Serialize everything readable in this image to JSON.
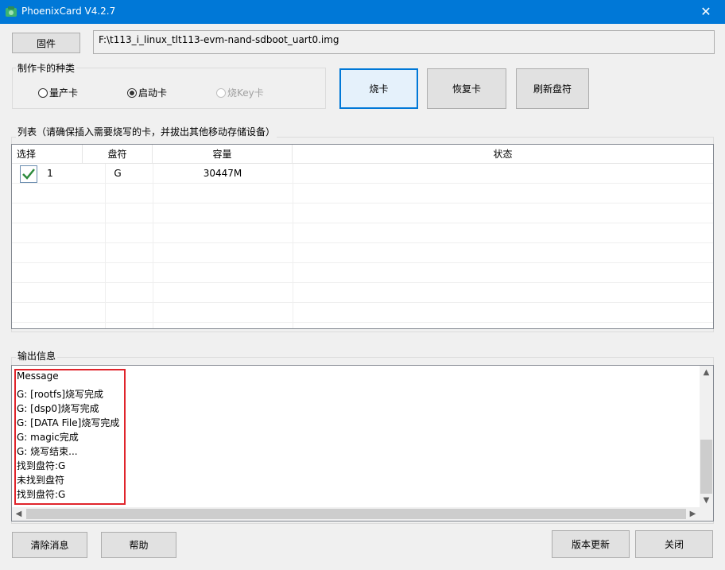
{
  "window": {
    "title": "PhoenixCard V4.2.7",
    "close_glyph": "✕"
  },
  "firmware": {
    "button_label": "固件",
    "path": "F:\\t113_i_linux_tlt113-evm-nand-sdboot_uart0.img"
  },
  "card_type": {
    "label": "制作卡的种类",
    "options": [
      {
        "label": "量产卡",
        "selected": false,
        "enabled": true
      },
      {
        "label": "启动卡",
        "selected": true,
        "enabled": true
      },
      {
        "label": "烧Key卡",
        "selected": false,
        "enabled": false
      }
    ]
  },
  "actions": {
    "burn_label": "烧卡",
    "restore_label": "恢复卡",
    "refresh_label": "刷新盘符"
  },
  "list": {
    "label": "列表（请确保插入需要烧写的卡，并拔出其他移动存储设备）",
    "columns": [
      "选择",
      "盘符",
      "容量",
      "状态"
    ],
    "rows": [
      {
        "checked": true,
        "index": "1",
        "drive": "G",
        "capacity": "30447M",
        "status": ""
      }
    ]
  },
  "output": {
    "label": "输出信息",
    "messages": [
      "Message",
      "G: [rootfs]烧写完成",
      "G: [dsp0]烧写完成",
      "G: [DATA File]烧写完成",
      "G: magic完成",
      "G: 烧写结束...",
      "找到盘符:G",
      "未找到盘符",
      "找到盘符:G"
    ],
    "highlight_color": "#e0242b"
  },
  "footer": {
    "clear_label": "清除消息",
    "help_label": "帮助",
    "update_label": "版本更新",
    "close_label": "关闭"
  },
  "colors": {
    "titlebar": "#0078d7",
    "focus_border": "#0078d7",
    "checkmark": "#2e8b3d"
  },
  "icons": {
    "app": "phoenix-icon",
    "close": "close-icon",
    "check": "checkmark-icon",
    "scroll_up": "▲",
    "scroll_down": "▼",
    "scroll_left": "◀",
    "scroll_right": "▶"
  }
}
